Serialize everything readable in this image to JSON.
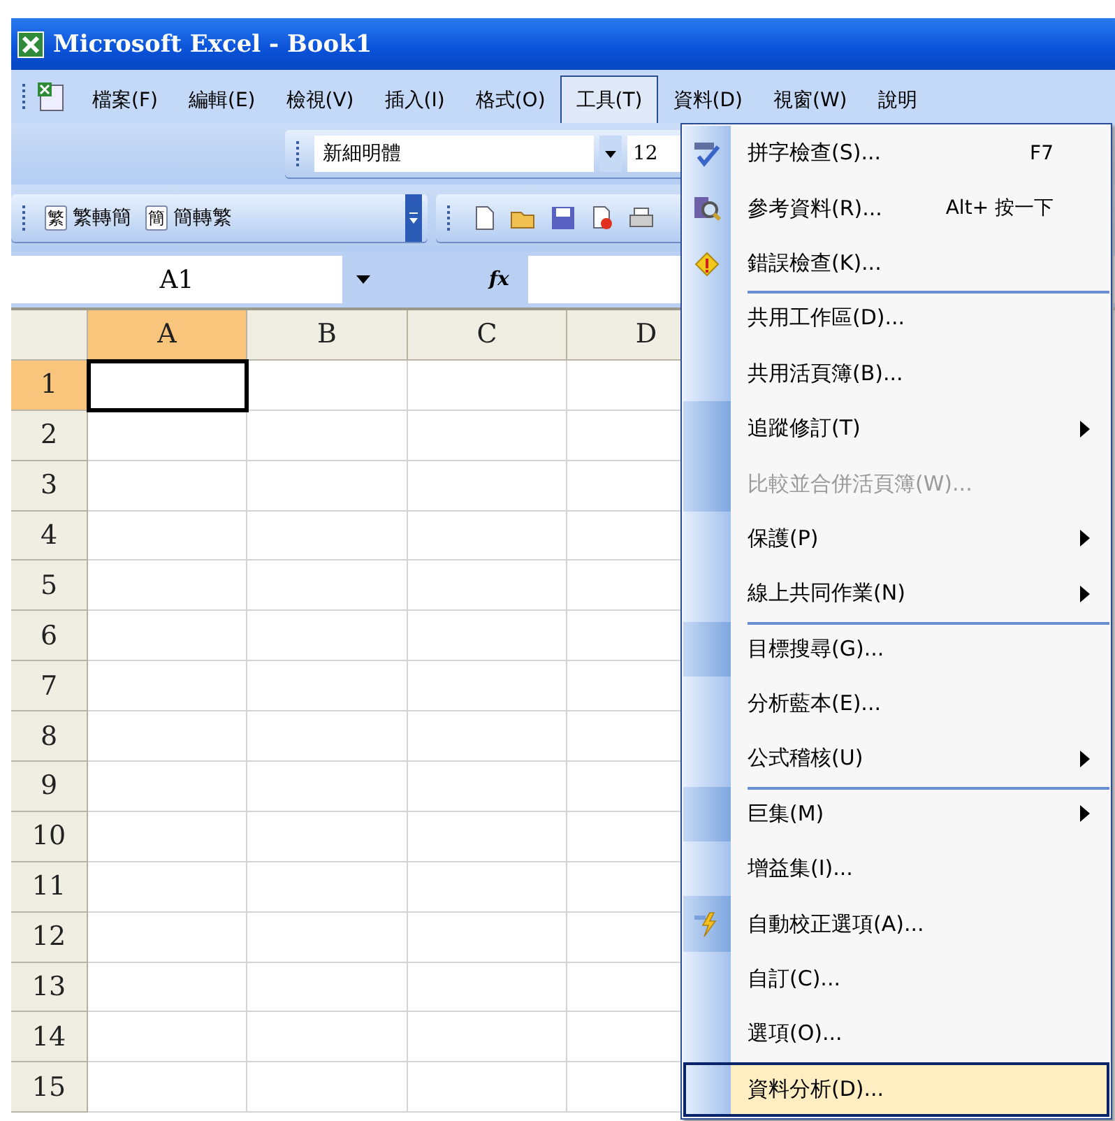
{
  "window": {
    "title": "Microsoft Excel - Book1"
  },
  "menu_bar": [
    {
      "label": "檔案(F)",
      "selected": false
    },
    {
      "label": "編輯(E)",
      "selected": false
    },
    {
      "label": "檢視(V)",
      "selected": false
    },
    {
      "label": "插入(I)",
      "selected": false
    },
    {
      "label": "格式(O)",
      "selected": false
    },
    {
      "label": "工具(T)",
      "selected": true
    },
    {
      "label": "資料(D)",
      "selected": false
    },
    {
      "label": "視窗(W)",
      "selected": false
    },
    {
      "label": "說明",
      "selected": false
    }
  ],
  "font_toolbar": {
    "font": "新細明體",
    "size": "12"
  },
  "conversion_toolbar": [
    {
      "glyph": "繁",
      "label": "繁轉簡"
    },
    {
      "glyph": "簡",
      "label": "簡轉繁"
    }
  ],
  "formula_bar": {
    "name_box": "A1",
    "fx": "fx"
  },
  "grid": {
    "columns": [
      {
        "label": "A",
        "selected": true
      },
      {
        "label": "B",
        "selected": false
      },
      {
        "label": "C",
        "selected": false
      },
      {
        "label": "D",
        "selected": false
      }
    ],
    "rows": [
      {
        "label": "1",
        "selected": true
      },
      {
        "label": "2",
        "selected": false
      },
      {
        "label": "3",
        "selected": false
      },
      {
        "label": "4",
        "selected": false
      },
      {
        "label": "5",
        "selected": false
      },
      {
        "label": "6",
        "selected": false
      },
      {
        "label": "7",
        "selected": false
      },
      {
        "label": "8",
        "selected": false
      },
      {
        "label": "9",
        "selected": false
      },
      {
        "label": "10",
        "selected": false
      },
      {
        "label": "11",
        "selected": false
      },
      {
        "label": "12",
        "selected": false
      },
      {
        "label": "13",
        "selected": false
      },
      {
        "label": "14",
        "selected": false
      },
      {
        "label": "15",
        "selected": false
      }
    ]
  },
  "tools_menu": [
    {
      "kind": "spelling",
      "label": "拼字檢查(S)...",
      "shortcut": "F7",
      "separator_above": false,
      "rarely_used": false,
      "disabled": false,
      "submenu": false,
      "selected": false
    },
    {
      "kind": "research",
      "label": "參考資料(R)...",
      "shortcut": "Alt+ 按一下",
      "separator_above": false,
      "rarely_used": false,
      "disabled": false,
      "submenu": false,
      "selected": false
    },
    {
      "kind": "error-check",
      "label": "錯誤檢查(K)...",
      "separator_above": false,
      "rarely_used": false,
      "disabled": false,
      "submenu": false,
      "selected": false
    },
    {
      "kind": "plain",
      "label": "共用工作區(D)...",
      "separator_above": true,
      "rarely_used": false,
      "disabled": false,
      "submenu": false,
      "selected": false
    },
    {
      "kind": "plain",
      "label": "共用活頁簿(B)...",
      "separator_above": false,
      "rarely_used": false,
      "disabled": false,
      "submenu": false,
      "selected": false
    },
    {
      "kind": "plain",
      "label": "追蹤修訂(T)",
      "separator_above": false,
      "rarely_used": true,
      "disabled": false,
      "submenu": true,
      "selected": false
    },
    {
      "kind": "plain",
      "label": "比較並合併活頁簿(W)...",
      "separator_above": false,
      "rarely_used": true,
      "disabled": true,
      "submenu": false,
      "selected": false
    },
    {
      "kind": "plain",
      "label": "保護(P)",
      "separator_above": false,
      "rarely_used": false,
      "disabled": false,
      "submenu": true,
      "selected": false
    },
    {
      "kind": "plain",
      "label": "線上共同作業(N)",
      "separator_above": false,
      "rarely_used": false,
      "disabled": false,
      "submenu": true,
      "selected": false
    },
    {
      "kind": "plain",
      "label": "目標搜尋(G)...",
      "separator_above": true,
      "rarely_used": true,
      "disabled": false,
      "submenu": false,
      "selected": false
    },
    {
      "kind": "plain",
      "label": "分析藍本(E)...",
      "separator_above": false,
      "rarely_used": false,
      "disabled": false,
      "submenu": false,
      "selected": false
    },
    {
      "kind": "plain",
      "label": "公式稽核(U)",
      "separator_above": false,
      "rarely_used": false,
      "disabled": false,
      "submenu": true,
      "selected": false
    },
    {
      "kind": "plain",
      "label": "巨集(M)",
      "separator_above": true,
      "rarely_used": true,
      "disabled": false,
      "submenu": true,
      "selected": false
    },
    {
      "kind": "plain",
      "label": "增益集(I)...",
      "separator_above": false,
      "rarely_used": false,
      "disabled": false,
      "submenu": false,
      "selected": false
    },
    {
      "kind": "autocorrect",
      "label": "自動校正選項(A)...",
      "separator_above": false,
      "rarely_used": true,
      "disabled": false,
      "submenu": false,
      "selected": false
    },
    {
      "kind": "plain",
      "label": "自訂(C)...",
      "separator_above": false,
      "rarely_used": false,
      "disabled": false,
      "submenu": false,
      "selected": false
    },
    {
      "kind": "plain",
      "label": "選項(O)...",
      "separator_above": false,
      "rarely_used": false,
      "disabled": false,
      "submenu": false,
      "selected": false
    },
    {
      "kind": "plain",
      "label": "資料分析(D)...",
      "separator_above": false,
      "rarely_used": false,
      "disabled": false,
      "submenu": false,
      "selected": true
    }
  ]
}
